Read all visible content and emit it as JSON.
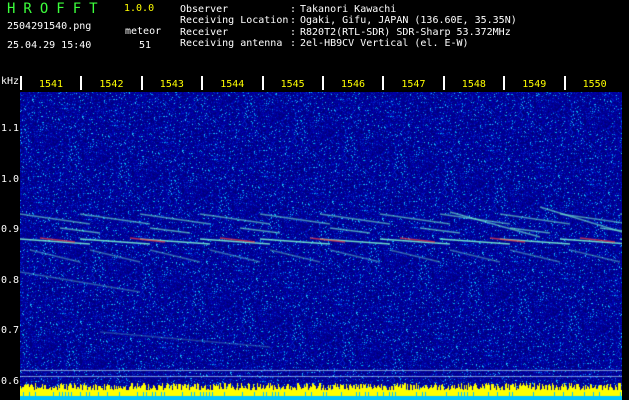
{
  "app": {
    "title": "HROFFT",
    "version": "1.0.0",
    "file_name": "2504291540.png",
    "datetime": "25.04.29 15:40",
    "meteor_label": "meteor",
    "meteor_count": "51"
  },
  "info": [
    {
      "key": "Observer",
      "value": "Takanori Kawachi"
    },
    {
      "key": "Receiving Location",
      "value": "Ogaki, Gifu, JAPAN (136.60E, 35.35N)"
    },
    {
      "key": "Receiver",
      "value": "R820T2(RTL-SDR) SDR-Sharp 53.372MHz"
    },
    {
      "key": "Receiving antenna",
      "value": "2el-HB9CV Vertical (el. E-W)"
    }
  ],
  "axis": {
    "unit": "kHz",
    "time_ticks": [
      "1541",
      "1542",
      "1543",
      "1544",
      "1545",
      "1546",
      "1547",
      "1548",
      "1549",
      "1550"
    ],
    "freq_ticks": [
      "1.1",
      "1.0",
      "0.9",
      "0.8",
      "0.7",
      "0.6"
    ]
  },
  "colors": {
    "background": "#000000",
    "header_green": "#3cff3c",
    "spectrogram_base": "#00008c",
    "echo_line": "#7fffd4",
    "strong_echo": "#ff4040",
    "noise_floor": "#ffff00",
    "noise_floor_base": "#00c8ff"
  }
}
